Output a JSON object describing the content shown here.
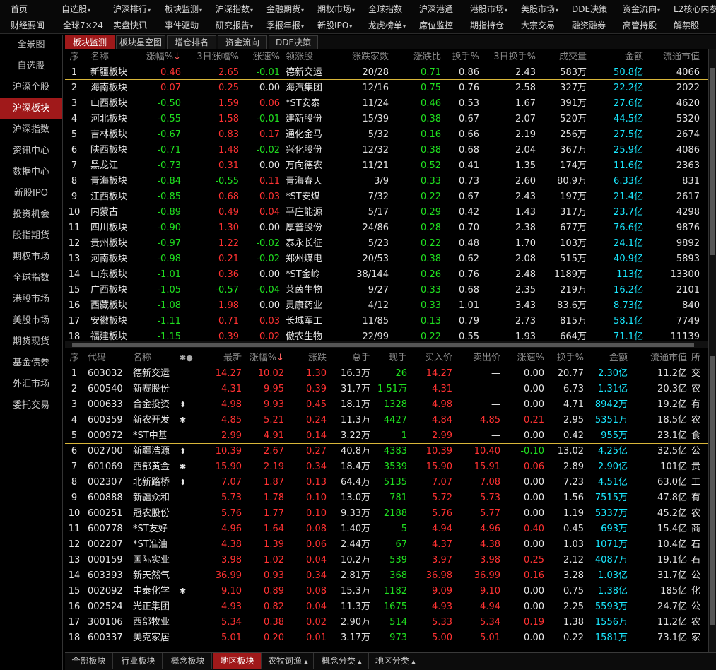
{
  "menu": {
    "row1": [
      {
        "label": "首页",
        "dd": false
      },
      {
        "label": "自选股",
        "dd": true
      },
      {
        "label": "沪深排行",
        "dd": true
      },
      {
        "label": "板块监测",
        "dd": true
      },
      {
        "label": "沪深指数",
        "dd": true
      },
      {
        "label": "金融期货",
        "dd": true
      },
      {
        "label": "期权市场",
        "dd": true
      },
      {
        "label": "全球指数",
        "dd": false
      },
      {
        "label": "沪深港通",
        "dd": false
      },
      {
        "label": "港股市场",
        "dd": true
      },
      {
        "label": "美股市场",
        "dd": true
      },
      {
        "label": "DDE决策",
        "dd": false
      },
      {
        "label": "资金流向",
        "dd": true
      },
      {
        "label": "L2核心内参",
        "dd": false
      }
    ],
    "row2": [
      {
        "label": "财经要闻",
        "dd": false
      },
      {
        "label": "全球7×24",
        "dd": false
      },
      {
        "label": "实盘快讯",
        "dd": false
      },
      {
        "label": "事件驱动",
        "dd": false
      },
      {
        "label": "研究报告",
        "dd": true
      },
      {
        "label": "季报年报",
        "dd": true
      },
      {
        "label": "新股IPO",
        "dd": true
      },
      {
        "label": "龙虎榜单",
        "dd": true
      },
      {
        "label": "席位监控",
        "dd": false
      },
      {
        "label": "期指持仓",
        "dd": false
      },
      {
        "label": "大宗交易",
        "dd": false
      },
      {
        "label": "融资融券",
        "dd": false
      },
      {
        "label": "高管持股",
        "dd": false
      },
      {
        "label": "解禁股",
        "dd": false
      }
    ]
  },
  "sidebar": {
    "items": [
      "全景图",
      "自选股",
      "沪深个股",
      "沪深板块",
      "沪深指数",
      "资讯中心",
      "数据中心",
      "新股IPO",
      "投资机会",
      "股指期货",
      "期权市场",
      "全球指数",
      "港股市场",
      "美股市场",
      "期货现货",
      "基金债券",
      "外汇市场",
      "委托交易"
    ],
    "active_index": 3
  },
  "top_tabs": {
    "items": [
      "板块监测",
      "板块星空图",
      "增仓排名",
      "资金流向",
      "DDE决策"
    ],
    "active_index": 0
  },
  "sector_table": {
    "headers": [
      "序",
      "名称",
      "涨幅%",
      "3日涨幅%",
      "涨速%",
      "领涨股",
      "涨跌家数",
      "涨跌比",
      "换手%",
      "3日换手%",
      "成交量",
      "金额",
      "流通市值"
    ],
    "sort_arrow": "↓",
    "rows": [
      [
        "1",
        "新疆板块",
        "0.46",
        "2.65",
        "-0.01",
        "德新交运",
        "20/28",
        "0.71",
        "0.86",
        "2.43",
        "583万",
        "50.8亿",
        "4066"
      ],
      [
        "2",
        "海南板块",
        "0.07",
        "0.25",
        "0.00",
        "海汽集团",
        "12/16",
        "0.75",
        "0.76",
        "2.58",
        "327万",
        "22.2亿",
        "2022"
      ],
      [
        "3",
        "山西板块",
        "-0.50",
        "1.59",
        "0.06",
        "*ST安泰",
        "11/24",
        "0.46",
        "0.53",
        "1.67",
        "391万",
        "27.6亿",
        "4620"
      ],
      [
        "4",
        "河北板块",
        "-0.55",
        "1.58",
        "-0.01",
        "建新股份",
        "15/39",
        "0.38",
        "0.67",
        "2.07",
        "520万",
        "44.5亿",
        "5320"
      ],
      [
        "5",
        "吉林板块",
        "-0.67",
        "0.83",
        "0.17",
        "通化金马",
        "5/32",
        "0.16",
        "0.66",
        "2.19",
        "256万",
        "27.5亿",
        "2674"
      ],
      [
        "6",
        "陕西板块",
        "-0.71",
        "1.48",
        "-0.02",
        "兴化股份",
        "12/32",
        "0.38",
        "0.68",
        "2.04",
        "367万",
        "25.9亿",
        "4086"
      ],
      [
        "7",
        "黑龙江",
        "-0.73",
        "0.31",
        "0.00",
        "万向德农",
        "11/21",
        "0.52",
        "0.41",
        "1.35",
        "174万",
        "11.6亿",
        "2363"
      ],
      [
        "8",
        "青海板块",
        "-0.84",
        "-0.55",
        "0.11",
        "青海春天",
        "3/9",
        "0.33",
        "0.73",
        "2.60",
        "80.9万",
        "6.33亿",
        "831"
      ],
      [
        "9",
        "江西板块",
        "-0.85",
        "0.68",
        "0.03",
        "*ST安煤",
        "7/32",
        "0.22",
        "0.67",
        "2.43",
        "197万",
        "21.4亿",
        "2617"
      ],
      [
        "10",
        "内蒙古",
        "-0.89",
        "0.49",
        "0.04",
        "平庄能源",
        "5/17",
        "0.29",
        "0.42",
        "1.43",
        "317万",
        "23.7亿",
        "4298"
      ],
      [
        "11",
        "四川板块",
        "-0.90",
        "1.30",
        "0.00",
        "厚普股份",
        "24/86",
        "0.28",
        "0.70",
        "2.38",
        "677万",
        "76.6亿",
        "9876"
      ],
      [
        "12",
        "贵州板块",
        "-0.97",
        "1.22",
        "-0.02",
        "泰永长征",
        "5/23",
        "0.22",
        "0.48",
        "1.70",
        "103万",
        "24.1亿",
        "9892"
      ],
      [
        "13",
        "河南板块",
        "-0.98",
        "0.21",
        "-0.02",
        "郑州煤电",
        "20/53",
        "0.38",
        "0.62",
        "2.08",
        "515万",
        "40.9亿",
        "5893"
      ],
      [
        "14",
        "山东板块",
        "-1.01",
        "0.36",
        "0.00",
        "*ST金岭",
        "38/144",
        "0.26",
        "0.76",
        "2.48",
        "1189万",
        "113亿",
        "13300"
      ],
      [
        "15",
        "广西板块",
        "-1.05",
        "-0.57",
        "-0.04",
        "莱茵生物",
        "9/27",
        "0.33",
        "0.68",
        "2.35",
        "219万",
        "16.2亿",
        "2101"
      ],
      [
        "16",
        "西藏板块",
        "-1.08",
        "1.98",
        "0.00",
        "灵康药业",
        "4/12",
        "0.33",
        "1.01",
        "3.43",
        "83.6万",
        "8.73亿",
        "840"
      ],
      [
        "17",
        "安徽板块",
        "-1.11",
        "0.71",
        "0.03",
        "长城军工",
        "11/85",
        "0.13",
        "0.79",
        "2.73",
        "815万",
        "58.1亿",
        "7749"
      ],
      [
        "18",
        "福建板块",
        "-1.15",
        "0.39",
        "0.02",
        "傲农生物",
        "22/99",
        "0.22",
        "0.55",
        "1.93",
        "664万",
        "71.1亿",
        "11139"
      ]
    ]
  },
  "stock_table": {
    "headers": [
      "序",
      "代码",
      "名称",
      "最新",
      "涨幅%",
      "涨跌",
      "总手",
      "现手",
      "买入价",
      "卖出价",
      "涨速%",
      "换手%",
      "金额",
      "流通市值",
      "所"
    ],
    "icons_header": "✱●",
    "sort_arrow": "↓",
    "rows": [
      [
        "1",
        "603032",
        "德新交运",
        "",
        "14.27",
        "10.02",
        "1.30",
        "16.3万",
        "26",
        "14.27",
        "—",
        "0.00",
        "20.77",
        "2.30亿",
        "11.2亿",
        "交"
      ],
      [
        "2",
        "600540",
        "新赛股份",
        "",
        "4.31",
        "9.95",
        "0.39",
        "31.7万",
        "1.51万",
        "4.31",
        "—",
        "0.00",
        "6.73",
        "1.31亿",
        "20.3亿",
        "农"
      ],
      [
        "3",
        "000633",
        "合金投资",
        "⬍",
        "4.98",
        "9.93",
        "0.45",
        "18.1万",
        "1328",
        "4.98",
        "—",
        "0.00",
        "4.71",
        "8942万",
        "19.2亿",
        "有"
      ],
      [
        "4",
        "600359",
        "新农开发",
        "✱",
        "4.85",
        "5.21",
        "0.24",
        "11.3万",
        "4427",
        "4.84",
        "4.85",
        "0.21",
        "2.95",
        "5351万",
        "18.5亿",
        "农"
      ],
      [
        "5",
        "000972",
        "*ST中基",
        "",
        "2.99",
        "4.91",
        "0.14",
        "3.22万",
        "1",
        "2.99",
        "—",
        "0.00",
        "0.42",
        "955万",
        "23.1亿",
        "食"
      ],
      [
        "6",
        "002700",
        "新疆浩源",
        "⬍",
        "10.39",
        "2.67",
        "0.27",
        "40.8万",
        "4383",
        "10.39",
        "10.40",
        "-0.10",
        "13.02",
        "4.25亿",
        "32.5亿",
        "公"
      ],
      [
        "7",
        "601069",
        "西部黄金",
        "✱",
        "15.90",
        "2.19",
        "0.34",
        "18.4万",
        "3539",
        "15.90",
        "15.91",
        "0.06",
        "2.89",
        "2.90亿",
        "101亿",
        "贵"
      ],
      [
        "8",
        "002307",
        "北新路桥",
        "⬍",
        "7.07",
        "1.87",
        "0.13",
        "64.4万",
        "5135",
        "7.07",
        "7.08",
        "0.00",
        "7.23",
        "4.51亿",
        "63.0亿",
        "工"
      ],
      [
        "9",
        "600888",
        "新疆众和",
        "",
        "5.73",
        "1.78",
        "0.10",
        "13.0万",
        "781",
        "5.72",
        "5.73",
        "0.00",
        "1.56",
        "7515万",
        "47.8亿",
        "有"
      ],
      [
        "10",
        "600251",
        "冠农股份",
        "",
        "5.76",
        "1.77",
        "0.10",
        "9.33万",
        "2188",
        "5.76",
        "5.77",
        "0.00",
        "1.19",
        "5337万",
        "45.2亿",
        "农"
      ],
      [
        "11",
        "600778",
        "*ST友好",
        "",
        "4.96",
        "1.64",
        "0.08",
        "1.40万",
        "5",
        "4.94",
        "4.96",
        "0.40",
        "0.45",
        "693万",
        "15.4亿",
        "商"
      ],
      [
        "12",
        "002207",
        "*ST准油",
        "",
        "4.38",
        "1.39",
        "0.06",
        "2.44万",
        "67",
        "4.37",
        "4.38",
        "0.00",
        "1.03",
        "1071万",
        "10.4亿",
        "石"
      ],
      [
        "13",
        "000159",
        "国际实业",
        "",
        "3.98",
        "1.02",
        "0.04",
        "10.2万",
        "539",
        "3.97",
        "3.98",
        "0.25",
        "2.12",
        "4087万",
        "19.1亿",
        "石"
      ],
      [
        "14",
        "603393",
        "新天然气",
        "",
        "36.99",
        "0.93",
        "0.34",
        "2.81万",
        "368",
        "36.98",
        "36.99",
        "0.16",
        "3.28",
        "1.03亿",
        "31.7亿",
        "公"
      ],
      [
        "15",
        "002092",
        "中泰化学",
        "✱",
        "9.10",
        "0.89",
        "0.08",
        "15.3万",
        "1182",
        "9.09",
        "9.10",
        "0.00",
        "0.75",
        "1.38亿",
        "185亿",
        "化"
      ],
      [
        "16",
        "002524",
        "光正集团",
        "",
        "4.93",
        "0.82",
        "0.04",
        "11.3万",
        "1675",
        "4.93",
        "4.94",
        "0.00",
        "2.25",
        "5593万",
        "24.7亿",
        "公"
      ],
      [
        "17",
        "300106",
        "西部牧业",
        "",
        "5.34",
        "0.38",
        "0.02",
        "2.90万",
        "514",
        "5.33",
        "5.34",
        "0.19",
        "1.38",
        "1556万",
        "11.2亿",
        "农"
      ],
      [
        "18",
        "600337",
        "美克家居",
        "",
        "5.01",
        "0.20",
        "0.01",
        "3.17万",
        "973",
        "5.00",
        "5.01",
        "0.00",
        "0.22",
        "1581万",
        "73.1亿",
        "家"
      ]
    ]
  },
  "bottom_tabs": {
    "items": [
      {
        "label": "全部板块",
        "up": false
      },
      {
        "label": "行业板块",
        "up": false
      },
      {
        "label": "概念板块",
        "up": false
      },
      {
        "label": "地区板块",
        "up": false
      },
      {
        "label": "农牧饲渔",
        "up": true
      },
      {
        "label": "概念分类",
        "up": true
      },
      {
        "label": "地区分类",
        "up": true
      }
    ],
    "active_index": 3
  },
  "colors": {
    "accent": "#a0191a",
    "up": "#ff3232",
    "down": "#20e020",
    "amount": "#1ae8ff",
    "separator": "#d9b63a"
  }
}
